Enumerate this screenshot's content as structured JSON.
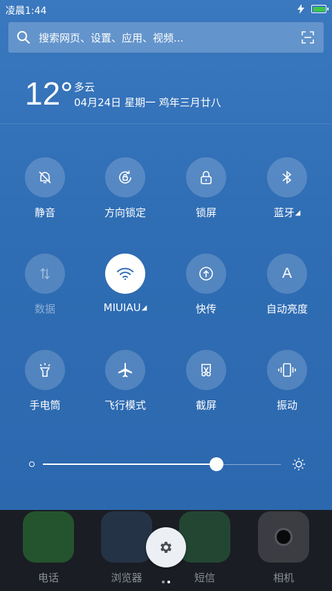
{
  "status_bar": {
    "time": "凌晨1:44",
    "battery_color": "#3ec44b",
    "battery_level": 1.0
  },
  "search": {
    "placeholder": "搜索网页、设置、应用、视频...",
    "icon": "search-icon",
    "scan_icon": "scan-icon"
  },
  "weather": {
    "temperature": "12°",
    "condition": "多云",
    "date": "04月24日 星期一 鸡年三月廿八"
  },
  "toggles": [
    {
      "label": "静音",
      "icon": "bell-off-icon"
    },
    {
      "label": "方向锁定",
      "icon": "rotation-lock-icon"
    },
    {
      "label": "锁屏",
      "icon": "lock-icon"
    },
    {
      "label": "蓝牙",
      "icon": "bluetooth-icon",
      "more": "◢"
    },
    {
      "label": "数据",
      "icon": "data-arrows-icon"
    },
    {
      "label": "MIUIAU",
      "icon": "wifi-icon",
      "more": "◢"
    },
    {
      "label": "快传",
      "icon": "upload-icon"
    },
    {
      "label": "自动亮度",
      "icon": "letter-a-icon",
      "glyph": "A"
    },
    {
      "label": "手电筒",
      "icon": "flashlight-icon"
    },
    {
      "label": "飞行模式",
      "icon": "airplane-icon"
    },
    {
      "label": "截屏",
      "icon": "screenshot-scissors-icon"
    },
    {
      "label": "振动",
      "icon": "vibrate-icon"
    }
  ],
  "brightness": {
    "level": 0.73
  },
  "dock": {
    "apps": [
      {
        "label": "电话",
        "color": "#2e9a3c"
      },
      {
        "label": "浏览器",
        "color": "#2f4a68"
      },
      {
        "label": "短信",
        "color": "#2f7a48"
      },
      {
        "label": "相机",
        "color": "#3b3d42"
      }
    ],
    "settings_icon": "gear-icon"
  },
  "colors": {
    "panel": "#2f6db5",
    "accent": "#ffffff"
  }
}
